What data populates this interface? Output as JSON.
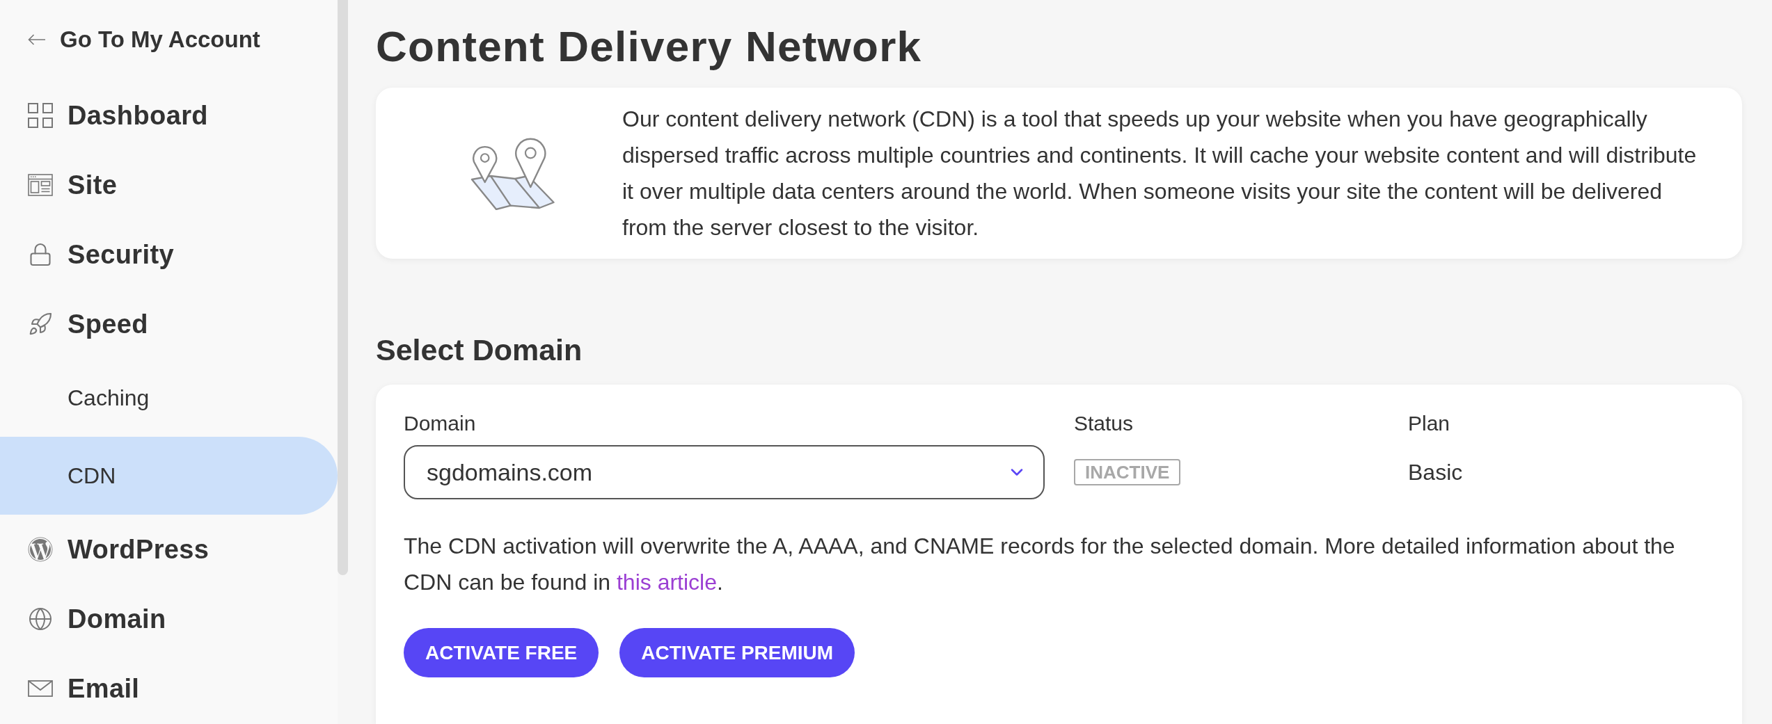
{
  "sidebar": {
    "back_link": {
      "label": "Go To My Account"
    },
    "items": [
      {
        "label": "Dashboard",
        "selected": false
      },
      {
        "label": "Site",
        "selected": false
      },
      {
        "label": "Security",
        "selected": false
      },
      {
        "label": "Speed",
        "selected": false,
        "children": [
          {
            "label": "Caching",
            "selected": false
          },
          {
            "label": "CDN",
            "selected": true
          }
        ]
      },
      {
        "label": "WordPress",
        "selected": false
      },
      {
        "label": "Domain",
        "selected": false
      },
      {
        "label": "Email",
        "selected": false
      }
    ]
  },
  "page": {
    "title": "Content Delivery Network"
  },
  "info_card": {
    "text": "Our content delivery network (CDN) is a tool that speeds up your website when you have geographically dispersed traffic across multiple countries and continents. It will cache your website content and will distribute it over multiple data centers around the world. When someone visits your site the content will be delivered from the server closest to the visitor."
  },
  "domain_section": {
    "heading": "Select Domain",
    "domain_label": "Domain",
    "domain_select": {
      "value": "sgdomains.com"
    },
    "status_label": "Status",
    "status_badge": "INACTIVE",
    "plan_label": "Plan",
    "plan_value": "Basic",
    "note": {
      "text_before": "The CDN activation will overwrite the A, AAAA, and CNAME records for the selected domain. More detailed information about the CDN can be found in ",
      "link": "this article",
      "text_after": "."
    },
    "buttons": [
      "ACTIVATE FREE",
      "ACTIVATE PREMIUM"
    ]
  }
}
